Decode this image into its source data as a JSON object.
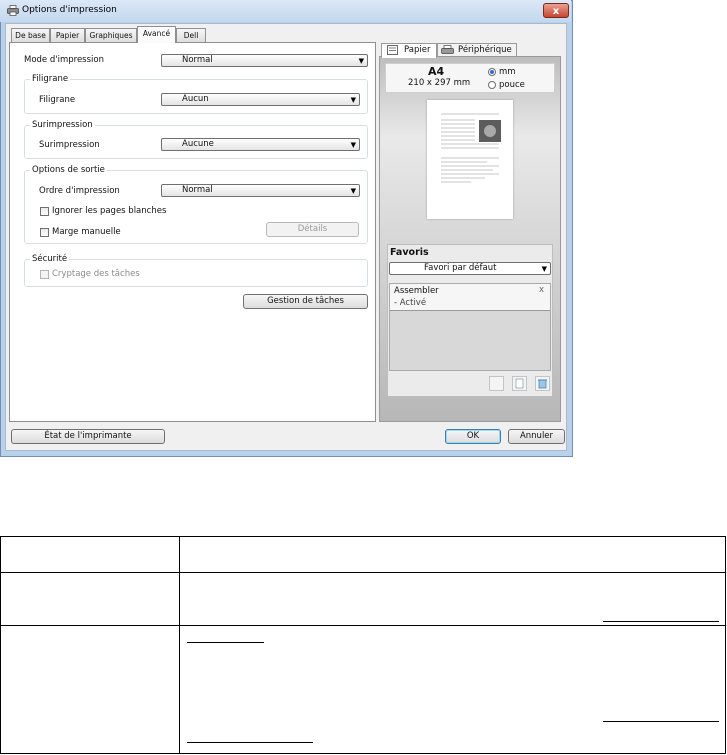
{
  "window": {
    "title": "Options d'impression",
    "close_label": "x"
  },
  "tabs": [
    {
      "label": "De base"
    },
    {
      "label": "Papier"
    },
    {
      "label": "Graphiques"
    },
    {
      "label": "Avancé",
      "active": true
    },
    {
      "label": "Dell"
    }
  ],
  "advanced": {
    "mode_label": "Mode d'impression",
    "mode_value": "Normal",
    "watermark_group": "Filigrane",
    "watermark_label": "Filigrane",
    "watermark_value": "Aucun",
    "overlay_group": "Surimpression",
    "overlay_label": "Surimpression",
    "overlay_value": "Aucune",
    "output_group": "Options de sortie",
    "order_label": "Ordre d'impression",
    "order_value": "Normal",
    "skip_blank_label": "Ignorer les pages blanches",
    "manual_margin_label": "Marge manuelle",
    "details_button": "Détails",
    "security_group": "Sécurité",
    "encryption_label": "Cryptage des tâches",
    "job_mgmt_button": "Gestion de tâches"
  },
  "preview": {
    "tab_paper": "Papier",
    "tab_device": "Périphérique",
    "paper_size": "A4",
    "paper_dims": "210 x 297 mm",
    "unit_mm": "mm",
    "unit_inch": "pouce",
    "unit_selected": "mm"
  },
  "favorites": {
    "title": "Favoris",
    "selected": "Favori par défaut",
    "item_title": "Assembler",
    "item_sub": "- Activé",
    "item_close": "x"
  },
  "footer": {
    "printer_status_button": "État de l'imprimante",
    "ok_button": "OK",
    "cancel_button": "Annuler"
  },
  "colors": {
    "window_frame": "#b9d1ea",
    "close_button": "#c8462d",
    "radio_selected": "#2a6fcf"
  }
}
